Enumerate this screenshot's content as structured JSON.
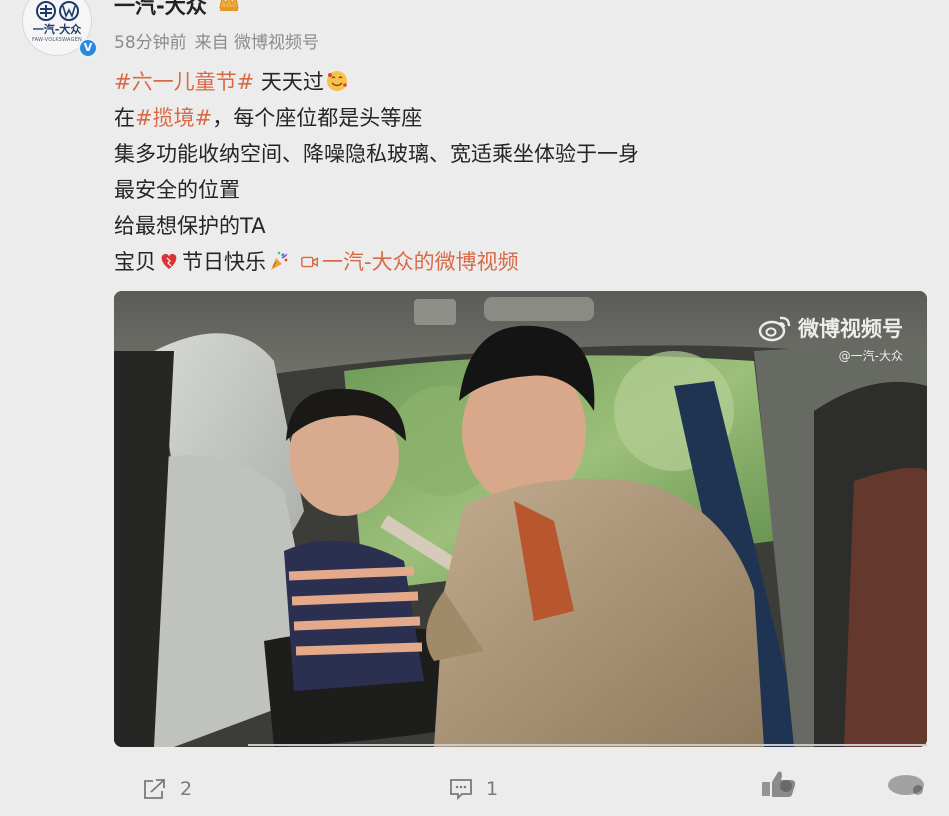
{
  "post": {
    "username": "一汽-大众",
    "avatar_text": "一汽-大众",
    "avatar_sub": "FAW-VOLKSWAGEN",
    "verified_mark": "V",
    "meta": {
      "time": "58分钟前",
      "source": "来自 微博视频号"
    },
    "content": {
      "line1_topic": "#六一儿童节#",
      "line1_text": " 天天过",
      "line2_prefix": "在",
      "line2_topic": "#揽境#",
      "line2_text": "，每个座位都是头等座",
      "line3": "集多功能收纳空间、降噪隐私玻璃、宽适乘坐体验于一身",
      "line4": "最安全的位置",
      "line5": "给最想保护的TA",
      "line6_a": "宝贝",
      "line6_b": "节日快乐",
      "video_link": "一汽-大众的微博视频"
    },
    "video": {
      "watermark_main": "微博视频号",
      "watermark_sub": "@一汽-大众"
    },
    "actions": {
      "share_count": "2",
      "comment_count": "1"
    }
  },
  "colors": {
    "topic": "#d96a45",
    "meta": "#8c8c8c",
    "verified": "#2a8ae0"
  },
  "icons": {
    "crown": "crown-icon",
    "smile": "smiling-face-hearts-icon",
    "heart": "heart-icon",
    "party": "party-popper-icon",
    "video": "video-camera-icon",
    "share": "share-icon",
    "comment": "comment-icon",
    "like": "like-icon",
    "more": "more-icon"
  }
}
